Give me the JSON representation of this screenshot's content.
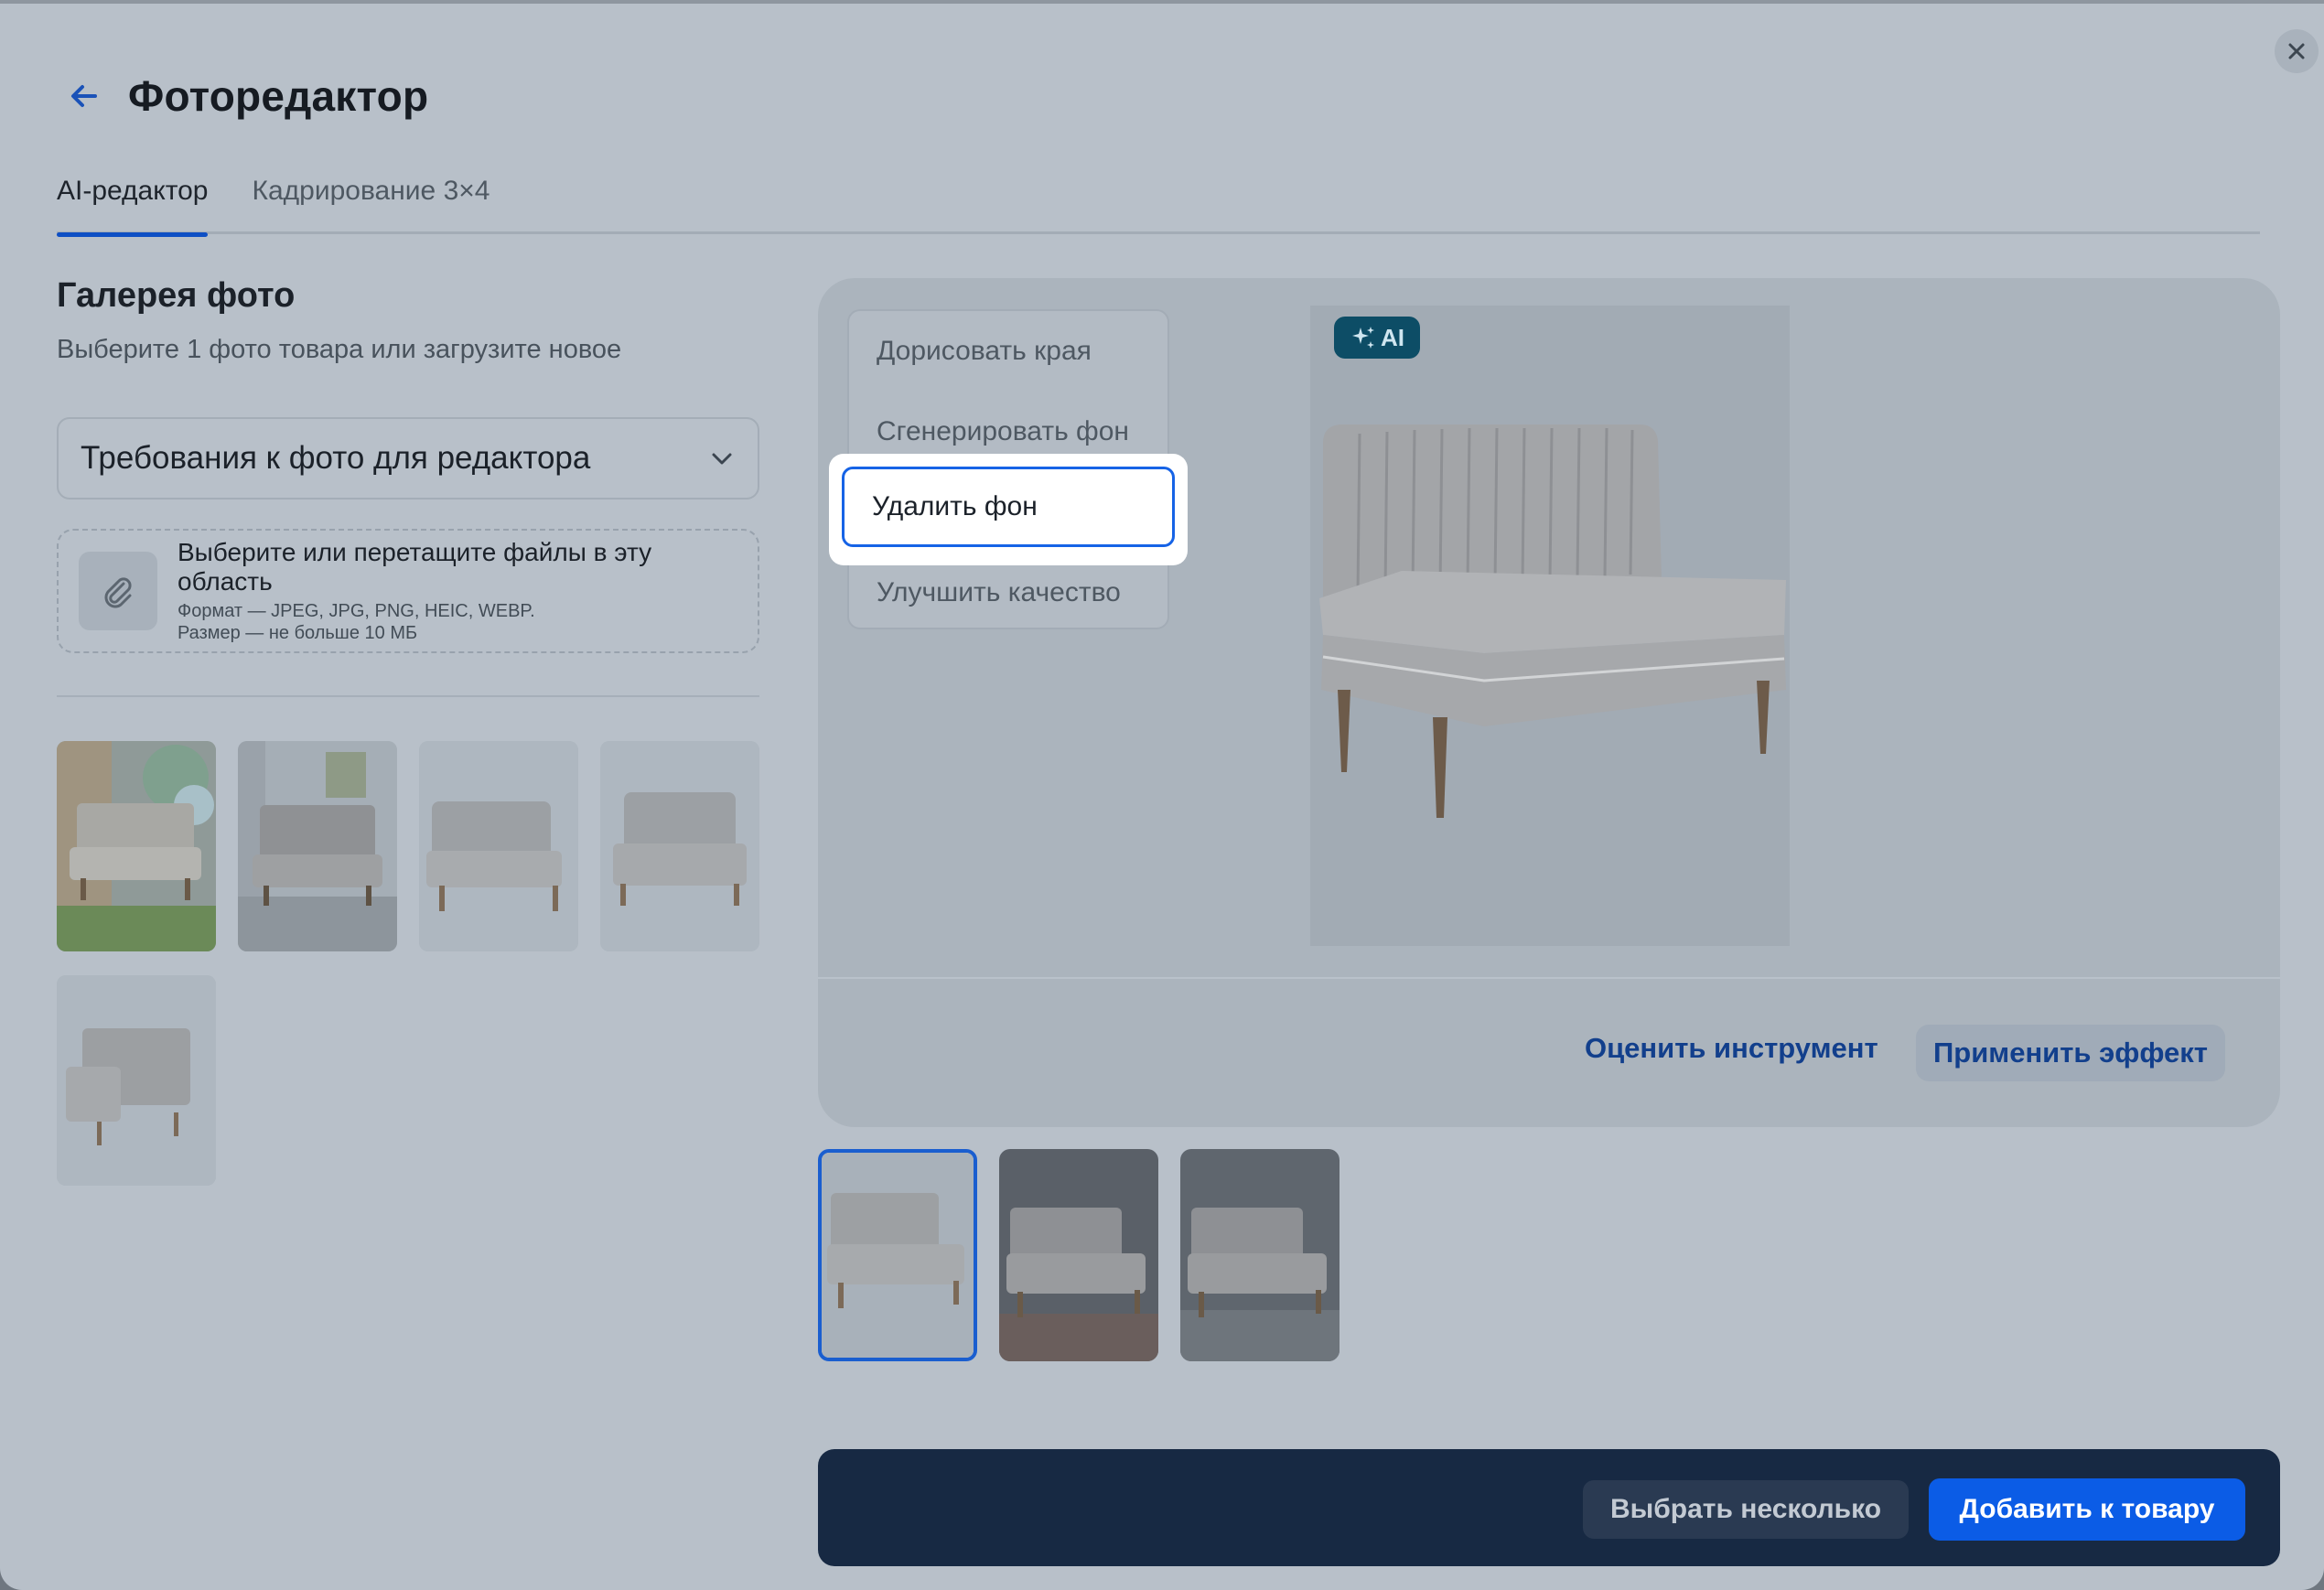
{
  "header": {
    "title": "Фоторедактор",
    "back_icon": "arrow-left-icon",
    "close_icon": "close-icon"
  },
  "tabs": [
    {
      "label": "AI-редактор",
      "active": true
    },
    {
      "label": "Кадрирование 3×4",
      "active": false
    }
  ],
  "gallery": {
    "title": "Галерея фото",
    "subtitle": "Выберите 1 фото товара или загрузите новое",
    "requirements_label": "Требования к фото для редактора",
    "dropzone": {
      "title": "Выберите или перетащите файлы в эту область",
      "format": "Формат — JPEG, JPG, PNG, HEIC, WEBP.",
      "size": "Размер — не больше 10 МБ",
      "icon": "paperclip-icon"
    }
  },
  "editor": {
    "tools": [
      {
        "label": "Дорисовать края"
      },
      {
        "label": "Сгенерировать фон"
      },
      {
        "label": "Удалить фон"
      },
      {
        "label": "Улучшить качество"
      }
    ],
    "selected_tool_index": 2,
    "ai_badge": "AI",
    "rate_label": "Оценить инструмент",
    "apply_label": "Применить эффект"
  },
  "actions": {
    "select_many_label": "Выбрать несколько",
    "add_label": "Добавить к товару"
  },
  "colors": {
    "accent": "#0b5ce6",
    "bottom_bar": "#172943",
    "ai_badge": "#0d4d66"
  }
}
